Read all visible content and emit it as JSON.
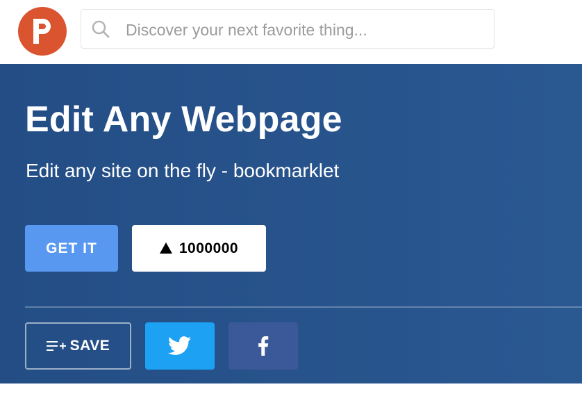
{
  "header": {
    "logo_letter": "P",
    "logo_color": "#da552f",
    "search": {
      "placeholder": "Discover your next favorite thing...",
      "value": "",
      "icon": "search-icon"
    }
  },
  "hero": {
    "background_color": "#26508a",
    "title": "Edit Any Webpage",
    "tagline": "Edit any site on the fly - bookmarklet",
    "get_it_label": "GET IT",
    "upvote_icon": "upvote-triangle-icon",
    "upvote_count": "1000000",
    "save_label": "SAVE",
    "save_icon": "playlist-add-icon",
    "share": [
      {
        "network": "Twitter",
        "icon": "twitter-icon",
        "color": "#1da1f2"
      },
      {
        "network": "Facebook",
        "icon": "facebook-icon",
        "color": "#3b5998"
      }
    ]
  }
}
